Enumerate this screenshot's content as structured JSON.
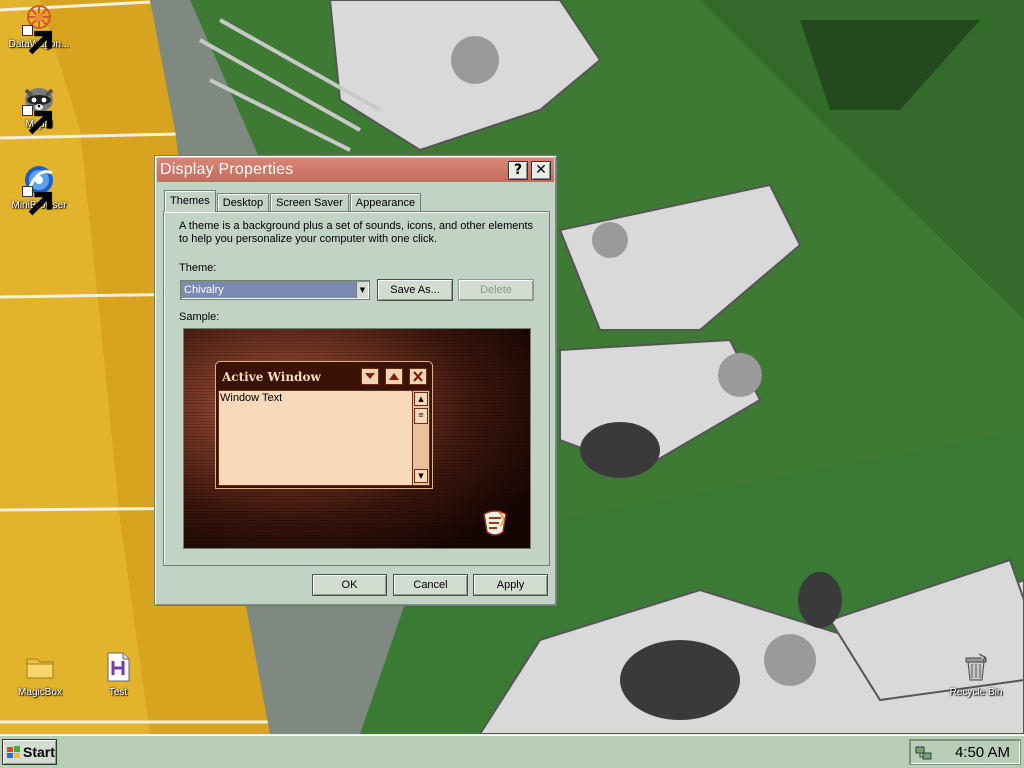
{
  "desktop": {
    "icons": [
      {
        "label": "DataWagon...",
        "icon": "datawagon-icon",
        "shortcut": true
      },
      {
        "label": "Mypal",
        "icon": "raccoon-browser-icon",
        "shortcut": true
      },
      {
        "label": "MiniBrowser",
        "icon": "globe-browser-icon",
        "shortcut": true
      },
      {
        "label": "MagicBox",
        "icon": "folder-icon",
        "shortcut": false
      },
      {
        "label": "Test",
        "icon": "document-h-icon",
        "shortcut": false
      },
      {
        "label": "Recycle Bin",
        "icon": "recycle-bin-icon",
        "shortcut": false
      }
    ]
  },
  "dialog": {
    "title": "Display Properties",
    "help_button": "?",
    "close_button": "✕",
    "tabs": [
      {
        "label": "Themes",
        "active": true
      },
      {
        "label": "Desktop",
        "active": false
      },
      {
        "label": "Screen Saver",
        "active": false
      },
      {
        "label": "Appearance",
        "active": false
      }
    ],
    "description": "A theme is a background plus a set of sounds, icons, and other elements to help you personalize your computer with one click.",
    "theme_label": "Theme:",
    "theme_value": "Chivalry",
    "save_as_button": "Save As...",
    "delete_button": "Delete",
    "sample_label": "Sample:",
    "sample": {
      "window_title": "Active Window",
      "window_text": "Window Text"
    },
    "ok_button": "OK",
    "cancel_button": "Cancel",
    "apply_button": "Apply"
  },
  "taskbar": {
    "start_label": "Start",
    "clock": "4:50 AM"
  },
  "colors": {
    "titlebar": "#c56b5c",
    "dialog_face": "#c2d2c4",
    "taskbar": "#b9ceb6",
    "selection": "#7a8ab0"
  }
}
